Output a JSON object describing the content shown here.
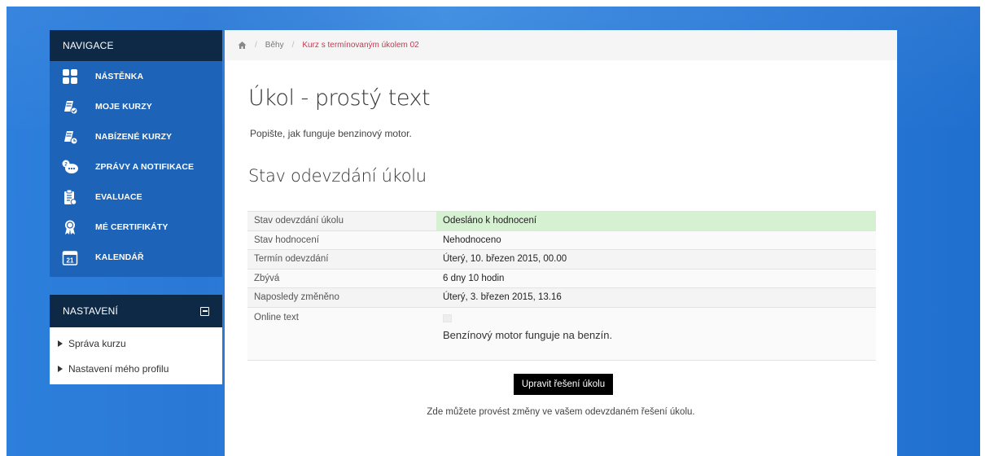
{
  "nav": {
    "header": "NAVIGACE",
    "items": [
      {
        "label": "NÁSTĚNKA",
        "icon": "dashboard-icon"
      },
      {
        "label": "MOJE KURZY",
        "icon": "my-courses-icon"
      },
      {
        "label": "NABÍZENÉ KURZY",
        "icon": "offered-courses-icon"
      },
      {
        "label": "ZPRÁVY A NOTIFIKACE",
        "icon": "messages-icon"
      },
      {
        "label": "EVALUACE",
        "icon": "evaluation-icon"
      },
      {
        "label": "MÉ CERTIFIKÁTY",
        "icon": "certificate-icon"
      },
      {
        "label": "KALENDÁŘ",
        "icon": "calendar-icon",
        "calendar_day": "21"
      }
    ]
  },
  "settings": {
    "header": "NASTAVENÍ",
    "items": [
      {
        "label": "Správa kurzu"
      },
      {
        "label": "Nastavení mého profilu"
      }
    ]
  },
  "breadcrumb": {
    "home_icon": "home-icon",
    "items": [
      "Běhy",
      "Kurz s termínovaným úkolem 02"
    ]
  },
  "page": {
    "title": "Úkol - prostý text",
    "intro": "Popište, jak funguje benzinový motor.",
    "section_title": "Stav odevzdání úkolu"
  },
  "status_table": [
    {
      "label": "Stav odevzdání úkolu",
      "value": "Odesláno k hodnocení"
    },
    {
      "label": "Stav hodnocení",
      "value": "Nehodnoceno"
    },
    {
      "label": "Termín odevzdání",
      "value": "Úterý, 10. březen 2015, 00.00"
    },
    {
      "label": "Zbývá",
      "value": "6 dny 10 hodin"
    },
    {
      "label": "Naposledy změněno",
      "value": "Úterý, 3. březen 2015, 13.16"
    },
    {
      "label": "Online text",
      "value": "Benzínový motor funguje na benzín."
    }
  ],
  "edit_button": "Upravit řešení úkolu",
  "help_text": "Zde můžete provést změny ve vašem odevzdaném řešení úkolu.",
  "colors": {
    "nav_bg": "#1d63b8",
    "header_bg": "#0d2946",
    "submitted_bg": "#d6f0d2",
    "breadcrumb_current": "#c9364f"
  }
}
